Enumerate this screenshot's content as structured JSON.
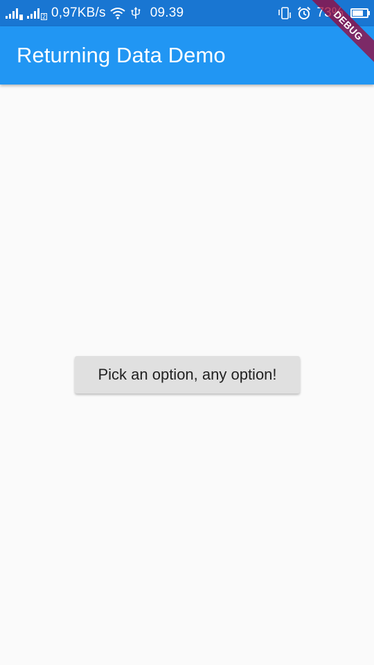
{
  "status_bar": {
    "network_speed": "0,97KB/s",
    "time": "09.39",
    "battery_percent": "73%",
    "battery_level": 0.73,
    "sim1_label": "",
    "sim2_label": "2",
    "icons": [
      "signal-icon",
      "signal-icon",
      "wifi-icon",
      "usb-icon",
      "vibrate-icon",
      "alarm-icon",
      "battery-icon"
    ]
  },
  "app_bar": {
    "title": "Returning Data Demo",
    "color": "#2196f3"
  },
  "debug_banner": {
    "label": "DEBUG"
  },
  "main": {
    "button_label": "Pick an option, any option!"
  }
}
